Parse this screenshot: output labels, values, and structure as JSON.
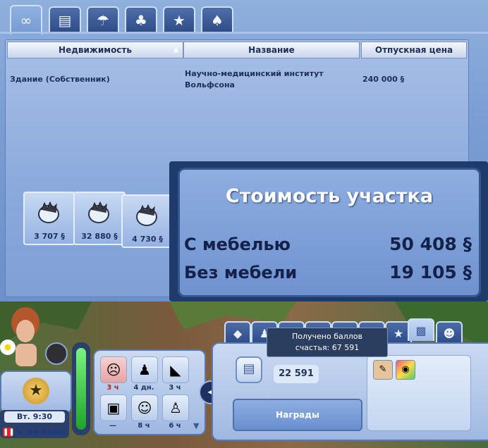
{
  "tabs": [
    {
      "icon": "infinity-icon",
      "glyph": "∞"
    },
    {
      "icon": "briefcase-icon",
      "glyph": "▤"
    },
    {
      "icon": "cafe-icon",
      "glyph": "☂"
    },
    {
      "icon": "palm-island-icon",
      "glyph": "♣"
    },
    {
      "icon": "star-map-icon",
      "glyph": "★"
    },
    {
      "icon": "palm-tree-icon",
      "glyph": "♠"
    }
  ],
  "table": {
    "headers": [
      "Недвижимость",
      "Название",
      "Отпускная цена"
    ],
    "rows": [
      {
        "property": "Здание (Собственник)",
        "name": "Научно-медицинский институт Вольфсона",
        "price": "240 000 §"
      }
    ]
  },
  "thumbnails": [
    {
      "price": "3 707 §"
    },
    {
      "price": "32 880 §"
    },
    {
      "price": "4 730 §"
    }
  ],
  "lot_value": {
    "title": "Стоимость участка",
    "furnished_label": "С мебелью",
    "furnished_value": "50 408 §",
    "unfurnished_label": "Без мебели",
    "unfurnished_value": "19 105 §"
  },
  "hud": {
    "time": "Вт. 9:30",
    "moodlets": [
      {
        "time": "3 ч",
        "icon": "sick-sim-icon",
        "glyph": "☹",
        "alert": true
      },
      {
        "time": "4 дн.",
        "icon": "relaxed-sim-icon",
        "glyph": "♟",
        "alert": false
      },
      {
        "time": "3 ч",
        "icon": "sandwich-icon",
        "glyph": "◣",
        "alert": false
      },
      {
        "time": "—",
        "icon": "painting-icon",
        "glyph": "▣",
        "alert": false
      },
      {
        "time": "8 ч",
        "icon": "happy-face-icon",
        "glyph": "☺",
        "alert": false
      },
      {
        "time": "6 ч",
        "icon": "cheering-sim-icon",
        "glyph": "♙",
        "alert": false
      }
    ],
    "tooltip_line1": "Получено баллов",
    "tooltip_line2": "счастья: 67 591",
    "lifetime_points": "22 591",
    "rewards_button": "Награды"
  },
  "colors": {
    "panel_blue": "#7a9dd3",
    "text_dark": "#1d2f57",
    "mood_green": "#2fb83a"
  }
}
